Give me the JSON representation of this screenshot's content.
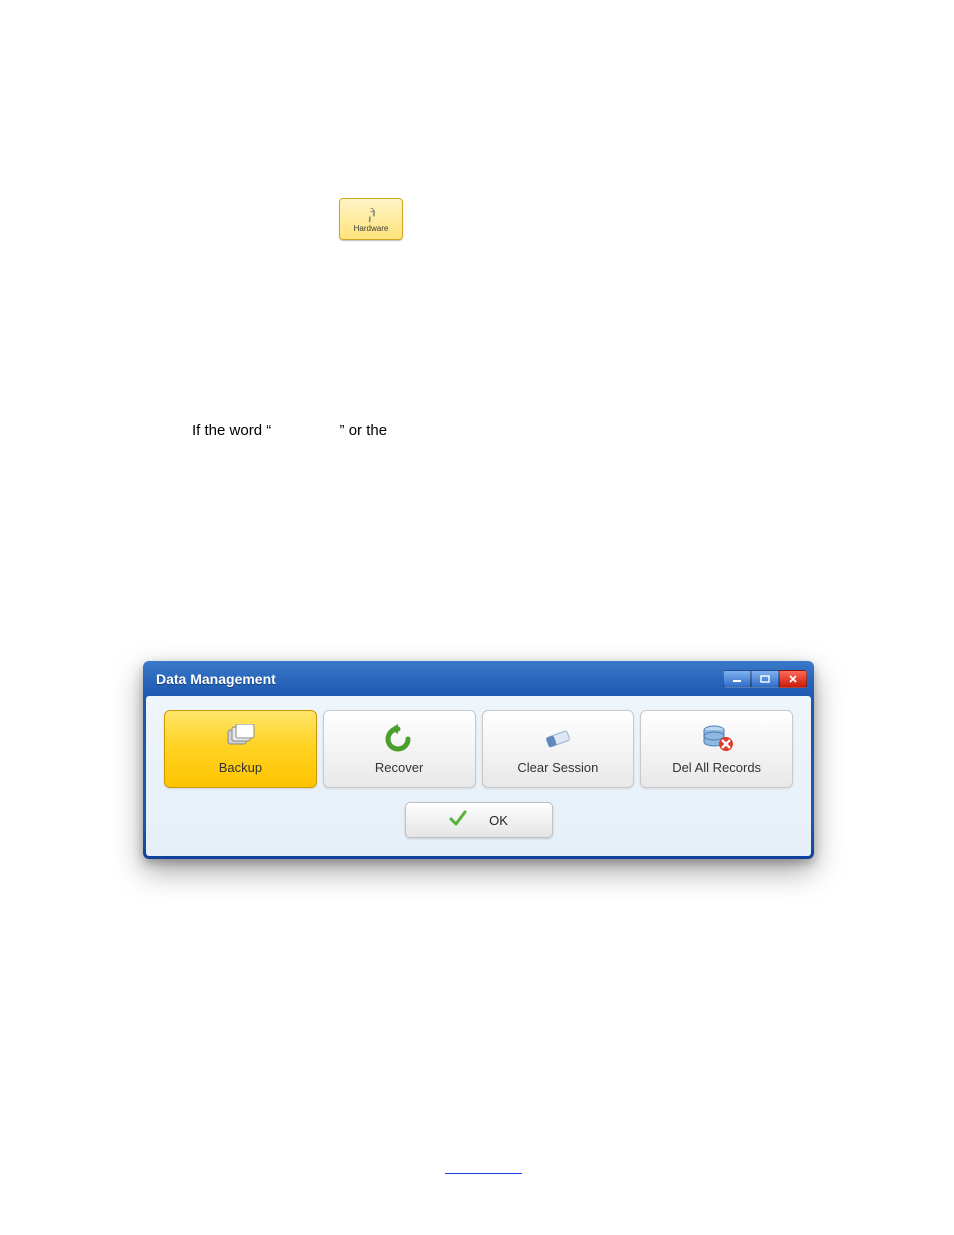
{
  "hardware_button": {
    "label": "Hardware",
    "icon": "wrench-icon"
  },
  "sentence": {
    "prefix": "If the word “",
    "suffix": "” or the"
  },
  "dialog": {
    "title": "Data Management",
    "buttons": {
      "backup": "Backup",
      "recover": "Recover",
      "clear_session": "Clear Session",
      "del_all": "Del All Records"
    },
    "ok": "OK",
    "active_button": "backup"
  }
}
